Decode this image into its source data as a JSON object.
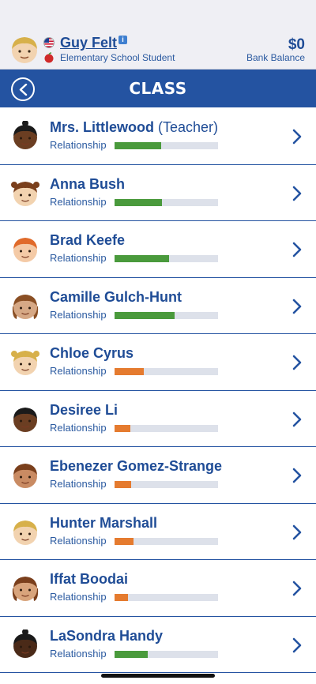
{
  "player": {
    "name": "Guy Felt",
    "subtitle": "Elementary School Student",
    "balance": "$0",
    "balance_label": "Bank Balance",
    "info_icon": "i"
  },
  "titlebar": {
    "title": "CLASS"
  },
  "students": [
    {
      "name": "Mrs. Littlewood",
      "role": "(Teacher)",
      "relationship_label": "Relationship",
      "relationship": 0.45,
      "bar_color": "#4a9a3c",
      "skin": "#6b3e22",
      "hair": "#1a1a1a",
      "hair_style": "bun"
    },
    {
      "name": "Anna Bush",
      "role": "",
      "relationship_label": "Relationship",
      "relationship": 0.46,
      "bar_color": "#4a9a3c",
      "skin": "#f2d3b0",
      "hair": "#7a3f1c",
      "hair_style": "pigtails"
    },
    {
      "name": "Brad Keefe",
      "role": "",
      "relationship_label": "Relationship",
      "relationship": 0.53,
      "bar_color": "#4a9a3c",
      "skin": "#f4caa6",
      "hair": "#e06a2a",
      "hair_style": "short"
    },
    {
      "name": "Camille Gulch-Hunt",
      "role": "",
      "relationship_label": "Relationship",
      "relationship": 0.58,
      "bar_color": "#4a9a3c",
      "skin": "#d6a885",
      "hair": "#8a4f24",
      "hair_style": "long"
    },
    {
      "name": "Chloe Cyrus",
      "role": "",
      "relationship_label": "Relationship",
      "relationship": 0.28,
      "bar_color": "#e57b2f",
      "skin": "#f2d3b0",
      "hair": "#d7b04a",
      "hair_style": "pigtails"
    },
    {
      "name": "Desiree Li",
      "role": "",
      "relationship_label": "Relationship",
      "relationship": 0.15,
      "bar_color": "#e57b2f",
      "skin": "#6b3e22",
      "hair": "#1a1a1a",
      "hair_style": "short"
    },
    {
      "name": "Ebenezer Gomez-Strange",
      "role": "",
      "relationship_label": "Relationship",
      "relationship": 0.16,
      "bar_color": "#e57b2f",
      "skin": "#c98b63",
      "hair": "#7a3f1c",
      "hair_style": "short"
    },
    {
      "name": "Hunter Marshall",
      "role": "",
      "relationship_label": "Relationship",
      "relationship": 0.18,
      "bar_color": "#e57b2f",
      "skin": "#f2d3b0",
      "hair": "#d7b04a",
      "hair_style": "short"
    },
    {
      "name": "Iffat Boodai",
      "role": "",
      "relationship_label": "Relationship",
      "relationship": 0.13,
      "bar_color": "#e57b2f",
      "skin": "#d8a47c",
      "hair": "#7a3f1c",
      "hair_style": "long"
    },
    {
      "name": "LaSondra Handy",
      "role": "",
      "relationship_label": "Relationship",
      "relationship": 0.32,
      "bar_color": "#4a9a3c",
      "skin": "#4a2a18",
      "hair": "#1a1a1a",
      "hair_style": "bun"
    }
  ],
  "icons": {
    "back": "chevron-left-icon",
    "row_arrow": "chevron-right-icon",
    "flag": "us-flag-icon",
    "apple": "apple-icon"
  }
}
